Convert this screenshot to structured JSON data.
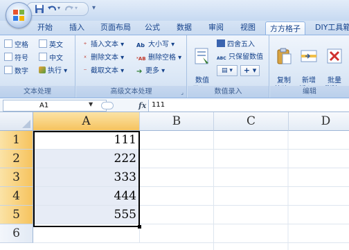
{
  "quick_access": {
    "icons": [
      "office-button",
      "save-icon",
      "undo-icon",
      "redo-icon",
      "customize-qat-icon"
    ]
  },
  "tabs": [
    "开始",
    "插入",
    "页面布局",
    "公式",
    "数据",
    "审阅",
    "视图",
    "方方格子",
    "DIY工具箱"
  ],
  "active_tab": "方方格子",
  "ribbon": {
    "text_group": {
      "title": "文本处理",
      "items": [
        "空格",
        "英文",
        "符号",
        "中文",
        "数字",
        "执行 ▾"
      ]
    },
    "advanced_group": {
      "title": "高级文本处理",
      "items": [
        "插入文本 ▾",
        "删除文本 ▾",
        "截取文本 ▾",
        "大小写 ▾",
        "删除空格 ▾",
        "更多 ▾"
      ]
    },
    "numeric_group": {
      "title": "数值录入",
      "big_button": "数值\n录入 ▾",
      "items": [
        "四舍五入",
        "只保留数值"
      ]
    },
    "edit_group": {
      "title": "编辑",
      "buttons": [
        "复制\n粘贴 ▾",
        "新增\n插入 ▾",
        "批量\n删除 ▾"
      ]
    }
  },
  "formula_bar": {
    "name_box": "A1",
    "fx_label": "fx",
    "formula": "111"
  },
  "grid": {
    "columns": [
      "A",
      "B",
      "C",
      "D"
    ],
    "rows": [
      "1",
      "2",
      "3",
      "4",
      "5",
      "6"
    ],
    "cells_A": [
      "111",
      "222",
      "333",
      "444",
      "555",
      ""
    ]
  },
  "colors": {
    "accent": "#15428b",
    "selection_header": "#f6c35e",
    "ribbon_bg": "#dfeaf7"
  }
}
